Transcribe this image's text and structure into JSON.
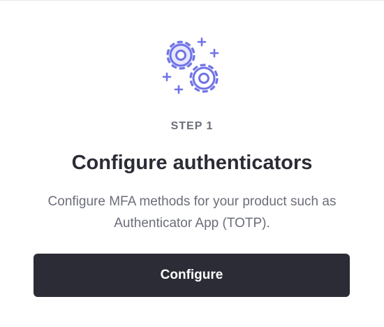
{
  "step_label": "STEP 1",
  "title": "Configure authenticators",
  "description": "Configure MFA methods for your product such as Authenticator App (TOTP).",
  "button_label": "Configure",
  "illustration_icon": "gears-icon",
  "colors": {
    "accent": "#6f73e6",
    "accent_fill": "#e6e7fb",
    "button_bg": "#2b2c35",
    "title": "#2b2c35",
    "muted": "#6b6e79"
  }
}
